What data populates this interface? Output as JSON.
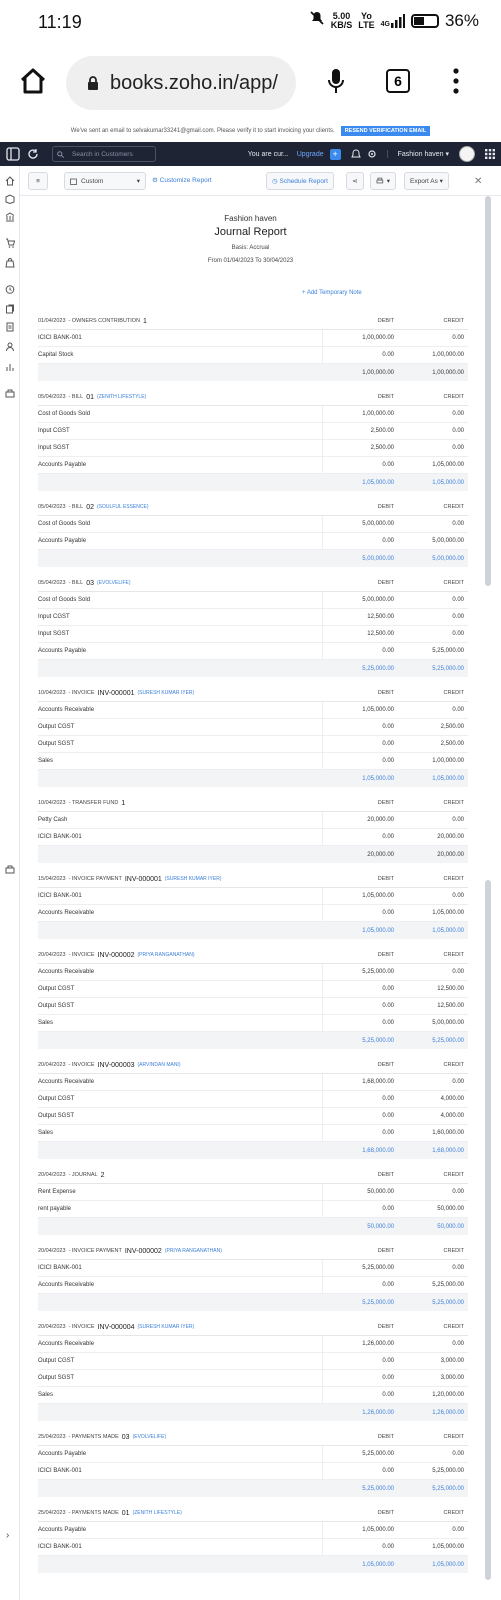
{
  "status_bar": {
    "time": "11:19",
    "net_speed_top": "5.00",
    "net_speed_bottom": "KB/S",
    "volte_top": "Yo",
    "volte_bottom": "LTE",
    "signal": "4G",
    "battery": "36%"
  },
  "browser": {
    "url": "books.zoho.in/app/",
    "tab_count": "6"
  },
  "notice": {
    "text": "We've sent an email to selvakumar33241@gmail.com. Please verify it to start invoicing your clients.",
    "verify_label": "RESEND VERIFICATION EMAIL"
  },
  "topnav": {
    "search_placeholder": "Search in Customers",
    "you_are": "You are cur...",
    "upgrade": "Upgrade",
    "org_name": "Fashion haven"
  },
  "toolbar": {
    "report_type": "Custom",
    "customize": "Customize Report",
    "schedule": "Schedule Report",
    "export": "Export As"
  },
  "report": {
    "org": "Fashion haven",
    "title": "Journal Report",
    "basis": "Basis: Accrual",
    "range": "From 01/04/2023 To 30/04/2023",
    "add_note": "+ Add Temporary Note",
    "debit_label": "DEBIT",
    "credit_label": "CREDIT"
  },
  "entries": [
    {
      "date": "01/04/2023",
      "type": "OWNERS CONTRIBUTION",
      "num": "1",
      "contact": "",
      "total_blue": false,
      "rows": [
        [
          "ICICI BANK-001",
          "1,00,000.00",
          "0.00"
        ],
        [
          "Capital Stock",
          "0.00",
          "1,00,000.00"
        ]
      ],
      "total": [
        "1,00,000.00",
        "1,00,000.00"
      ]
    },
    {
      "date": "05/04/2023",
      "type": "BILL",
      "num": "01",
      "contact": "(ZENITH LIFESTYLE)",
      "total_blue": true,
      "rows": [
        [
          "Cost of Goods Sold",
          "1,00,000.00",
          "0.00"
        ],
        [
          "Input CGST",
          "2,500.00",
          "0.00"
        ],
        [
          "Input SGST",
          "2,500.00",
          "0.00"
        ],
        [
          "Accounts Payable",
          "0.00",
          "1,05,000.00"
        ]
      ],
      "total": [
        "1,05,000.00",
        "1,05,000.00"
      ]
    },
    {
      "date": "05/04/2023",
      "type": "BILL",
      "num": "02",
      "contact": "(SOULFUL ESSENCE)",
      "total_blue": true,
      "rows": [
        [
          "Cost of Goods Sold",
          "5,00,000.00",
          "0.00"
        ],
        [
          "Accounts Payable",
          "0.00",
          "5,00,000.00"
        ]
      ],
      "total": [
        "5,00,000.00",
        "5,00,000.00"
      ]
    },
    {
      "date": "05/04/2023",
      "type": "BILL",
      "num": "03",
      "contact": "(EVOLVELIFE)",
      "total_blue": true,
      "rows": [
        [
          "Cost of Goods Sold",
          "5,00,000.00",
          "0.00"
        ],
        [
          "Input CGST",
          "12,500.00",
          "0.00"
        ],
        [
          "Input SGST",
          "12,500.00",
          "0.00"
        ],
        [
          "Accounts Payable",
          "0.00",
          "5,25,000.00"
        ]
      ],
      "total": [
        "5,25,000.00",
        "5,25,000.00"
      ]
    },
    {
      "date": "10/04/2023",
      "type": "INVOICE",
      "num": "INV-000001",
      "contact": "(SURESH KUMAR IYER)",
      "total_blue": true,
      "rows": [
        [
          "Accounts Receivable",
          "1,05,000.00",
          "0.00"
        ],
        [
          "Output CGST",
          "0.00",
          "2,500.00"
        ],
        [
          "Output SGST",
          "0.00",
          "2,500.00"
        ],
        [
          "Sales",
          "0.00",
          "1,00,000.00"
        ]
      ],
      "total": [
        "1,05,000.00",
        "1,05,000.00"
      ]
    },
    {
      "date": "10/04/2023",
      "type": "TRANSFER FUND",
      "num": "1",
      "contact": "",
      "total_blue": false,
      "rows": [
        [
          "Petty Cash",
          "20,000.00",
          "0.00"
        ],
        [
          "ICICI BANK-001",
          "0.00",
          "20,000.00"
        ]
      ],
      "total": [
        "20,000.00",
        "20,000.00"
      ]
    },
    {
      "date": "15/04/2023",
      "type": "INVOICE PAYMENT",
      "num": "INV-000001",
      "contact": "(SURESH KUMAR IYER)",
      "total_blue": true,
      "rows": [
        [
          "ICICI BANK-001",
          "1,05,000.00",
          "0.00"
        ],
        [
          "Accounts Receivable",
          "0.00",
          "1,05,000.00"
        ]
      ],
      "total": [
        "1,05,000.00",
        "1,05,000.00"
      ]
    },
    {
      "date": "20/04/2023",
      "type": "INVOICE",
      "num": "INV-000002",
      "contact": "(PRIYA RANGANATHAN)",
      "total_blue": true,
      "rows": [
        [
          "Accounts Receivable",
          "5,25,000.00",
          "0.00"
        ],
        [
          "Output CGST",
          "0.00",
          "12,500.00"
        ],
        [
          "Output SGST",
          "0.00",
          "12,500.00"
        ],
        [
          "Sales",
          "0.00",
          "5,00,000.00"
        ]
      ],
      "total": [
        "5,25,000.00",
        "5,25,000.00"
      ]
    },
    {
      "date": "20/04/2023",
      "type": "INVOICE",
      "num": "INV-000003",
      "contact": "(ARVINDAN MANI)",
      "total_blue": true,
      "rows": [
        [
          "Accounts Receivable",
          "1,68,000.00",
          "0.00"
        ],
        [
          "Output CGST",
          "0.00",
          "4,000.00"
        ],
        [
          "Output SGST",
          "0.00",
          "4,000.00"
        ],
        [
          "Sales",
          "0.00",
          "1,60,000.00"
        ]
      ],
      "total": [
        "1,68,000.00",
        "1,68,000.00"
      ]
    },
    {
      "date": "20/04/2023",
      "type": "JOURNAL",
      "num": "2",
      "contact": "",
      "total_blue": true,
      "rows": [
        [
          "Rent Expense",
          "50,000.00",
          "0.00"
        ],
        [
          "rent payable",
          "0.00",
          "50,000.00"
        ]
      ],
      "total": [
        "50,000.00",
        "50,000.00"
      ]
    },
    {
      "date": "20/04/2023",
      "type": "INVOICE PAYMENT",
      "num": "INV-000002",
      "contact": "(PRIYA RANGANATHAN)",
      "total_blue": true,
      "rows": [
        [
          "ICICI BANK-001",
          "5,25,000.00",
          "0.00"
        ],
        [
          "Accounts Receivable",
          "0.00",
          "5,25,000.00"
        ]
      ],
      "total": [
        "5,25,000.00",
        "5,25,000.00"
      ]
    },
    {
      "date": "20/04/2023",
      "type": "INVOICE",
      "num": "INV-000004",
      "contact": "(SURESH KUMAR IYER)",
      "total_blue": true,
      "rows": [
        [
          "Accounts Receivable",
          "1,26,000.00",
          "0.00"
        ],
        [
          "Output CGST",
          "0.00",
          "3,000.00"
        ],
        [
          "Output SGST",
          "0.00",
          "3,000.00"
        ],
        [
          "Sales",
          "0.00",
          "1,20,000.00"
        ]
      ],
      "total": [
        "1,26,000.00",
        "1,26,000.00"
      ]
    },
    {
      "date": "25/04/2023",
      "type": "PAYMENTS MADE",
      "num": "03",
      "contact": "(EVOLVELIFE)",
      "total_blue": true,
      "rows": [
        [
          "Accounts Payable",
          "5,25,000.00",
          "0.00"
        ],
        [
          "ICICI BANK-001",
          "0.00",
          "5,25,000.00"
        ]
      ],
      "total": [
        "5,25,000.00",
        "5,25,000.00"
      ]
    },
    {
      "date": "25/04/2023",
      "type": "PAYMENTS MADE",
      "num": "01",
      "contact": "(ZENITH LIFESTYLE)",
      "total_blue": true,
      "rows": [
        [
          "Accounts Payable",
          "1,05,000.00",
          "0.00"
        ],
        [
          "ICICI BANK-001",
          "0.00",
          "1,05,000.00"
        ]
      ],
      "total": [
        "1,05,000.00",
        "1,05,000.00"
      ]
    }
  ]
}
